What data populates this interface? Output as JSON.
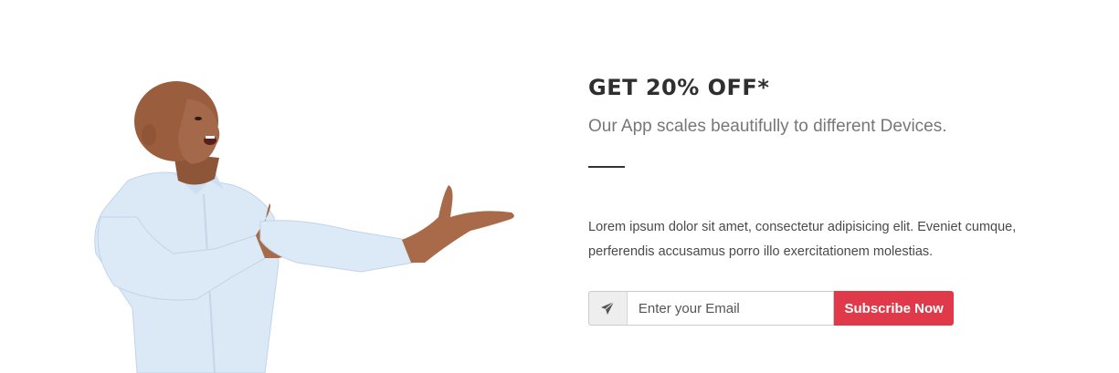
{
  "promo": {
    "title": "GET 20% OFF*",
    "subtitle": "Our App scales beautifully to different Devices.",
    "body": "Lorem ipsum dolor sit amet, consectetur adipisicing elit. Eveniet cumque, perferendis accusamus porro illo exercitationem molestias."
  },
  "subscribe": {
    "icon": "paper-plane-icon",
    "email_placeholder": "Enter your Email",
    "button_label": "Subscribe Now"
  },
  "colors": {
    "accent": "#e03a4a",
    "heading": "#2f2f2f",
    "subtitle": "#777777"
  }
}
